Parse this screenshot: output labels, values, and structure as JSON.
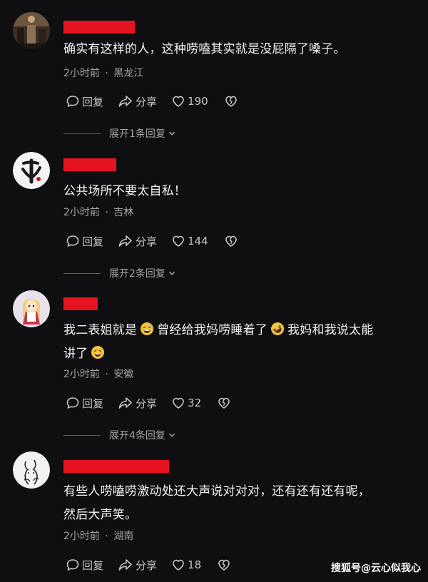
{
  "comments": [
    {
      "text": "确实有这样的人，这种唠嗑其实就是没屁隔了嗓子。",
      "time": "2小时前",
      "sep": "·",
      "location": "黑龙江",
      "reply_label": "回复",
      "share_label": "分享",
      "likes": "190",
      "expand_label": "展开1条回复"
    },
    {
      "text": "公共场所不要太自私！",
      "time": "2小时前",
      "sep": "·",
      "location": "吉林",
      "reply_label": "回复",
      "share_label": "分享",
      "likes": "144",
      "expand_label": "展开2条回复"
    },
    {
      "text_line1_a": "我二表姐就是",
      "text_line1_b": "曾经给我妈唠睡着了",
      "text_line1_c": "我妈和我说太能",
      "text_line2": "讲了",
      "time": "2小时前",
      "sep": "·",
      "location": "安徽",
      "reply_label": "回复",
      "share_label": "分享",
      "likes": "32",
      "expand_label": "展开4条回复"
    },
    {
      "text_line1": "有些人唠嗑唠激动处还大声说对对对，还有还有还有呢，",
      "text_line2": "然后大声笑。",
      "time": "2小时前",
      "sep": "·",
      "location": "湖南",
      "reply_label": "回复",
      "share_label": "分享",
      "likes": "18"
    }
  ],
  "watermark": "搜狐号@云心似我心",
  "colors": {
    "background": "#0f0f12",
    "redaction": "#e5131f",
    "text": "#f2f2f4",
    "meta": "#a3a3a8"
  },
  "icons": {
    "reply": "speech-bubble-icon",
    "share": "share-arrow-icon",
    "like": "heart-icon",
    "dislike": "broken-heart-icon",
    "expand": "chevron-down-icon"
  }
}
